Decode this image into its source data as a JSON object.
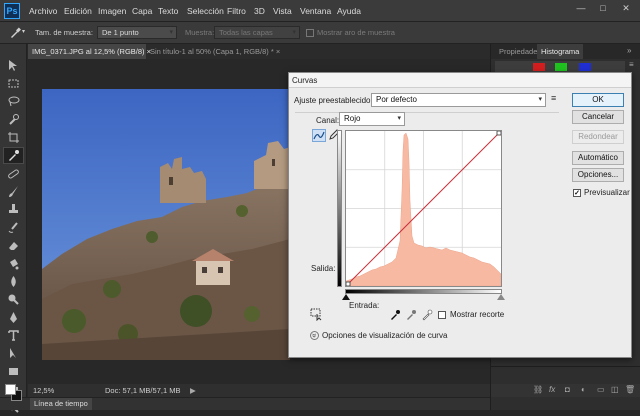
{
  "app": {
    "logo": "Ps"
  },
  "menubar": {
    "items": [
      "Archivo",
      "Edición",
      "Imagen",
      "Capa",
      "Texto",
      "Selección",
      "Filtro",
      "3D",
      "Vista",
      "Ventana",
      "Ayuda"
    ],
    "window_controls": [
      "—",
      "□",
      "✕"
    ]
  },
  "options": {
    "sample_size_label": "Tam. de muestra:",
    "sample_size_value": "De 1 punto",
    "sample_label": "Muestra:",
    "sample_value": "Todas las capas",
    "show_ring_label": "Mostrar aro de muestra"
  },
  "documents": {
    "tabs": [
      {
        "label": "IMG_0371.JPG al 12,5% (RGB/8)",
        "close": "×",
        "active": true
      },
      {
        "label": "Sin título-1 al 50% (Capa 1, RGB/8) *",
        "close": "×",
        "active": false
      }
    ]
  },
  "status": {
    "zoom": "12,5%",
    "doc_info": "Doc: 57,1 MB/57,1 MB",
    "arrow": "▶"
  },
  "timeline": {
    "label": "Línea de tiempo"
  },
  "panel": {
    "tabs": [
      "Propiedades",
      "Histograma"
    ],
    "menu_icon": "≡",
    "collapse_icon": "»"
  },
  "colors": {
    "accent": "#31a8ff",
    "histogram": "#f8b9a3",
    "curve": "#c8323c",
    "sky": "#4a77c8"
  },
  "dialog": {
    "title": "Curvas",
    "preset_label": "Ajuste preestablecido:",
    "preset_value": "Por defecto",
    "preset_menu_icon": "≡",
    "channel_label": "Canal:",
    "channel_value": "Rojo",
    "output_label": "Salida:",
    "input_label": "Entrada:",
    "show_clipping_label": "Mostrar recorte",
    "show_clipping_checked": false,
    "curve_options_label": "Opciones de visualización de curva",
    "curve_options_toggle": "»",
    "buttons": {
      "ok": "OK",
      "cancel": "Cancelar",
      "smooth": "Redondear",
      "auto": "Automático",
      "options": "Opciones..."
    },
    "preview_label": "Previsualizar",
    "preview_checked": true,
    "curve": {
      "input_range": [
        0,
        255
      ],
      "output_range": [
        0,
        255
      ],
      "points": [
        [
          0,
          0
        ],
        [
          255,
          255
        ]
      ]
    }
  }
}
